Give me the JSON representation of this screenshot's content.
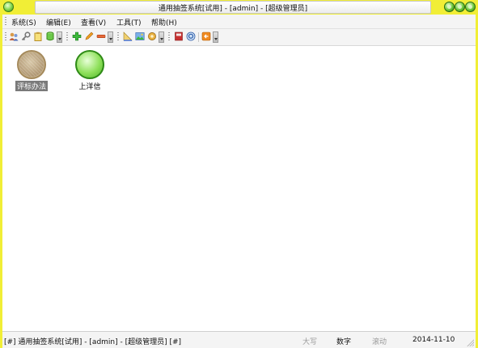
{
  "window": {
    "title": "通用抽签系统[试用] - [admin] - [超级管理员]"
  },
  "menu": {
    "items": [
      {
        "label": "系统(S)"
      },
      {
        "label": "编辑(E)"
      },
      {
        "label": "查看(V)"
      },
      {
        "label": "工具(T)"
      },
      {
        "label": "帮助(H)"
      }
    ]
  },
  "toolbar": {
    "icons": [
      "users-icon",
      "key-icon",
      "clipboard-icon",
      "database-icon",
      "add-icon",
      "edit-icon",
      "remove-icon",
      "ruler-icon",
      "image-icon",
      "gear-icon",
      "book-icon",
      "search-icon",
      "exit-icon"
    ]
  },
  "desktop": {
    "items": [
      {
        "label": "评标办法",
        "icon": "gray-orb-icon",
        "selected": true
      },
      {
        "label": "上洋信",
        "icon": "green-orb-icon",
        "selected": false
      }
    ]
  },
  "status": {
    "left_text": "[#] 通用抽签系统[试用] - [admin] - [超级管理员] [#]",
    "caps": "大写",
    "num": "数字",
    "scroll": "滚动",
    "date": "2014-11-10"
  },
  "colors": {
    "frame": "#f1ee36",
    "orb_green": "#6cc83a"
  }
}
